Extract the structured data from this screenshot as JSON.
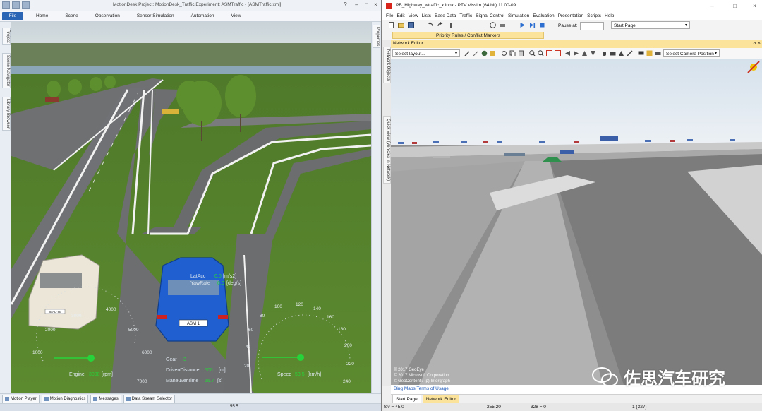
{
  "motiondesk": {
    "title": "MotionDesk  Project: MotionDesk_Traffic  Experiment: ASMTraffic - [ASMTraffic.xml]",
    "file_label": "File",
    "ribbon_tabs": [
      "Home",
      "Scene",
      "Observation",
      "Sensor Simulation",
      "Automation",
      "View"
    ],
    "left_panels": [
      "Project",
      "Scene Navigator",
      "Library Browser"
    ],
    "right_panel": "Properties",
    "bottom_tabs": [
      "Motion Player",
      "Motion Diagnostics",
      "Messages",
      "Data Stream Selector"
    ],
    "status_value": "55.5",
    "car_plate_left": "JEAD 8E",
    "car_plate_main": "ASM 1",
    "hud": {
      "latacc_label": "LatAcc",
      "latacc_value": "0.0",
      "latacc_unit": "[m/s2]",
      "yawrate_label": "YawRate",
      "yawrate_value": "0.0",
      "yawrate_unit": "[deg/s]",
      "gear_label": "Gear",
      "gear_value": "3",
      "distance_label": "DrivenDistance",
      "distance_value": "500",
      "distance_unit": "[m]",
      "time_label": "ManeuverTime",
      "time_value": "16.7",
      "time_unit": "[s]",
      "engine_label": "Engine",
      "engine_value": "3000",
      "engine_unit": "[rpm]",
      "speed_label": "Speed",
      "speed_value": "53.5",
      "speed_unit": "[km/h]"
    },
    "rpm_ticks": [
      "1000",
      "2000",
      "3000",
      "4000",
      "5000",
      "6000",
      "7000"
    ],
    "speed_ticks": [
      "20",
      "40",
      "60",
      "80",
      "100",
      "120",
      "140",
      "160",
      "180",
      "200",
      "220",
      "240"
    ]
  },
  "vissim": {
    "title": "PB_Highway_wtraffic_x.inpx - PTV Vissim (64 bit) 11.00-09",
    "menu": [
      "File",
      "Edit",
      "View",
      "Lists",
      "Base Data",
      "Traffic",
      "Signal Control",
      "Simulation",
      "Evaluation",
      "Presentation",
      "Scripts",
      "Help"
    ],
    "pause_label": "Pause at:",
    "start_page": "Start Page",
    "priority_bar": "Priority Rules / Conflict Markers",
    "network_editor_title": "Network Editor",
    "layout_placeholder": "Select layout...",
    "camera_select": "Select Camera Position",
    "side_labels": [
      "Network Objects",
      "Quick View (Vehicles In Network)"
    ],
    "copyright": [
      "© 2017 GeoEye",
      "© 2017 Microsoft Corporation",
      "© GeoContent / (p) Intergraph"
    ],
    "bing_link": "Bing Maps Terms of Usage",
    "tabs": [
      "Start Page",
      "Network Editor"
    ],
    "status": [
      "fov = 45.0",
      "255.20",
      "328 = 0",
      "1 (327)"
    ]
  },
  "watermark": "佐思汽车研究",
  "colors": {
    "ribbon_file": "#2a64b5",
    "vissim_accent": "#fbe39c",
    "car_blue": "#1f5fd0",
    "hud_green": "#27d33a"
  }
}
